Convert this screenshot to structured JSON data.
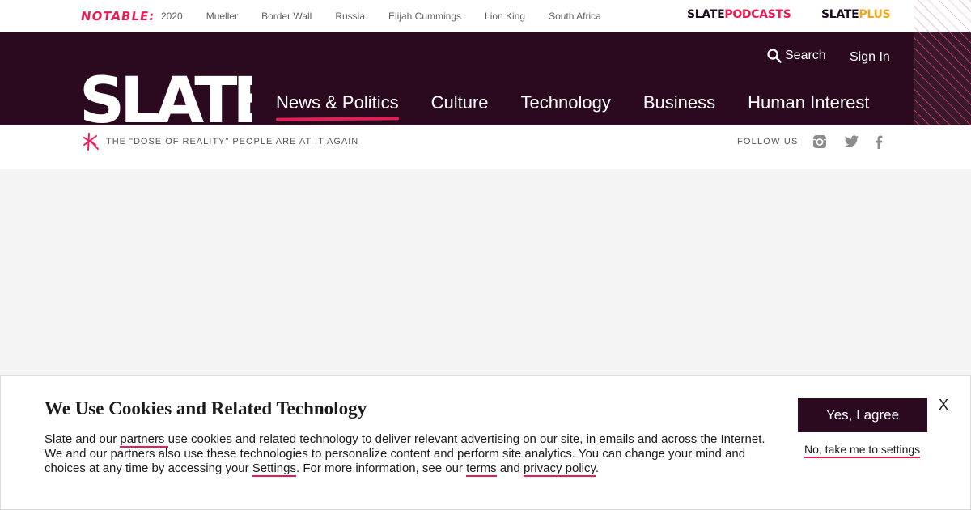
{
  "topbar": {
    "notable_label": "NOTABLE:",
    "trending": [
      "2020",
      "Mueller",
      "Border Wall",
      "Russia",
      "Elijah Cummings",
      "Lion King",
      "South Africa"
    ],
    "podcasts_brand": "SLATE",
    "podcasts_label": "PODCASTS",
    "plus_brand": "SLATE",
    "plus_label": "PLUS"
  },
  "header": {
    "search_label": "Search",
    "signin_label": "Sign In",
    "logo_text": "SLATE",
    "nav": [
      "News & Politics",
      "Culture",
      "Technology",
      "Business",
      "Human Interest"
    ],
    "active_nav": "News & Politics"
  },
  "subbar": {
    "tease": "THE \"DOSE OF REALITY\" PEOPLE ARE AT IT AGAIN",
    "follow_label": "FOLLOW US",
    "social_icons": [
      "instagram-icon",
      "twitter-icon",
      "facebook-icon"
    ]
  },
  "cookie": {
    "title": "We Use Cookies and Related Technology",
    "text_1": "Slate and our ",
    "link_partners": "partners ",
    "text_2": "use cookies and related technology to deliver relevant advertising on our site, in emails and across the Internet. We and our partners also use these technologies to personalize content and perform site analytics. You can change your mind and choices at any time by accessing your ",
    "link_settings": "Settings",
    "text_3": ". For more information, see our ",
    "link_terms": "terms",
    "text_4": " and ",
    "link_privacy": "privacy policy",
    "text_5": ".",
    "agree_label": "Yes, I agree",
    "settings_label": "No, take me to settings",
    "close_label": "X"
  },
  "colors": {
    "brand_dark": "#2b0a1f",
    "accent_pink": "#e81b53",
    "accent_gold": "#f2a71b"
  }
}
